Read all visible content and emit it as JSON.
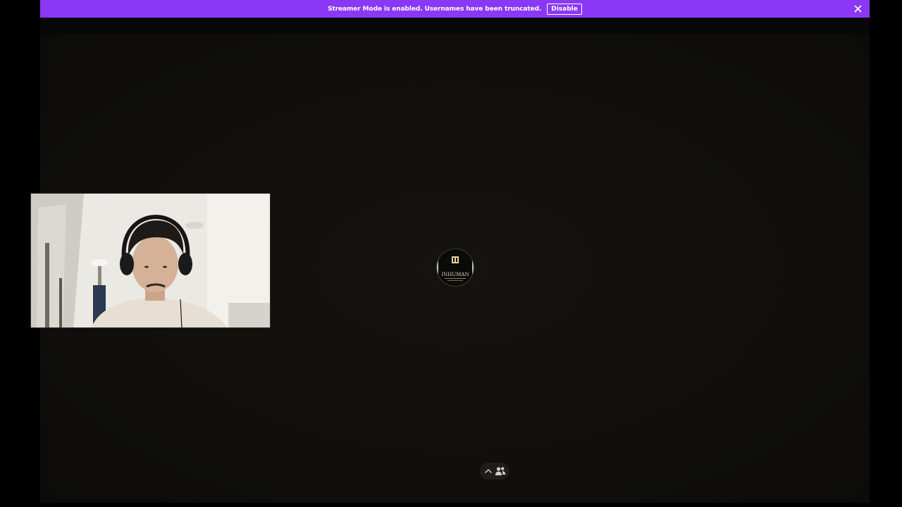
{
  "banner": {
    "message": "Streamer Mode is enabled. Usernames have been truncated.",
    "disable_label": "Disable",
    "close_icon": "close-icon",
    "color": "#8a38f5"
  },
  "stage": {
    "video_tile": {
      "content": "webcam-feed"
    },
    "avatar": {
      "icon": "server-avatar",
      "text": "INHUMAN"
    },
    "participants_toggle": {
      "icons": [
        "chevron-up-icon",
        "people-icon"
      ]
    }
  }
}
